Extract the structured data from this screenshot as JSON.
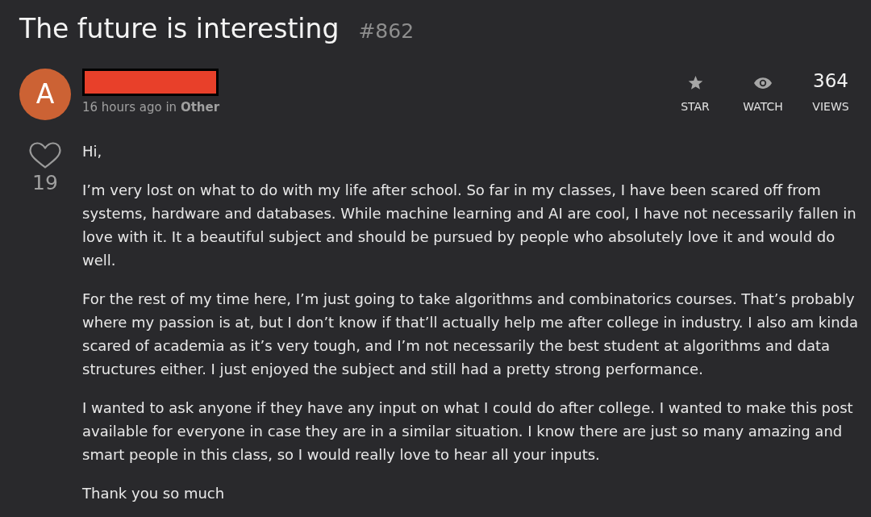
{
  "post": {
    "title": "The future is interesting",
    "number": "#862"
  },
  "author": {
    "avatar_letter": "A",
    "meta": "16 hours ago in **Other**"
  },
  "actions": [
    {
      "kind": "star",
      "label": "STAR"
    },
    {
      "kind": "watch",
      "label": "WATCH"
    },
    {
      "kind": "count",
      "value": "364",
      "label": "VIEWS"
    }
  ],
  "likes": {
    "liked": false,
    "count": "19"
  },
  "body": {
    "paragraphs": [
      "Hi,",
      "I’m very lost on what to do with my life after school. So far in my classes, I have been scared off from systems, hardware and databases. While machine learning and AI are cool, I have not necessarily fallen in love with it. It a beautiful subject and should be pursued by people who absolutely love it and would do well.",
      "For the rest of my time here, I’m just going to take algorithms and combinatorics courses. That’s probably where my passion is at, but I don’t know if that’ll actually help me after college in industry. I also am kinda scared of academia as it’s very tough, and I’m not necessarily the best student at algorithms and data structures either. I just enjoyed the subject and still had a pretty strong performance.",
      "I wanted to ask anyone if they have any input on what I could do after college. I wanted to make this post available for everyone in case they are in a similar situation. I know there are just so many amazing and smart people in this class, so I would really love to hear all your inputs.",
      "Thank you so much"
    ]
  }
}
